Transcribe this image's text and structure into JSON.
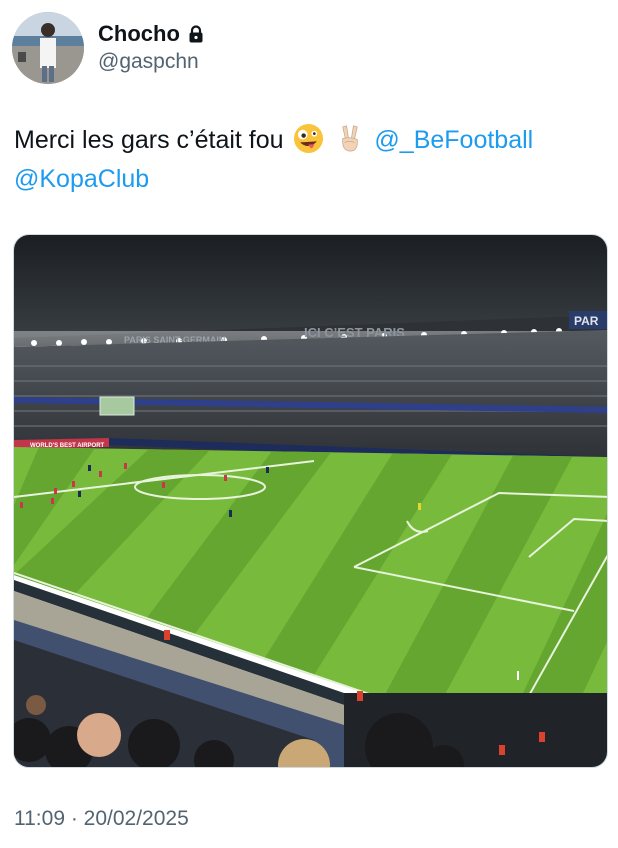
{
  "user": {
    "display_name": "Chocho",
    "handle": "@gaspchn",
    "protected_icon": "lock-icon"
  },
  "tweet": {
    "text_main": "Merci les gars c’était fou",
    "emoji_1": "zany-face-emoji",
    "emoji_2": "victory-hand-emoji",
    "mention_1": "@_BeFootball",
    "mention_2": "@KopaClub"
  },
  "media": {
    "stadium_banner_1": "PARIS SAINT-GERMAIN",
    "stadium_banner_2": "ICI C’EST PARIS",
    "stadium_banner_3": "PAR",
    "ad_board": "WORLD'S BEST AIRPORT"
  },
  "meta": {
    "timestamp": "11:09 · 20/02/2025"
  },
  "colors": {
    "link": "#1d9bf0",
    "secondary_text": "#536471",
    "pitch_light": "#78bb3c",
    "pitch_dark": "#5fa02c"
  }
}
